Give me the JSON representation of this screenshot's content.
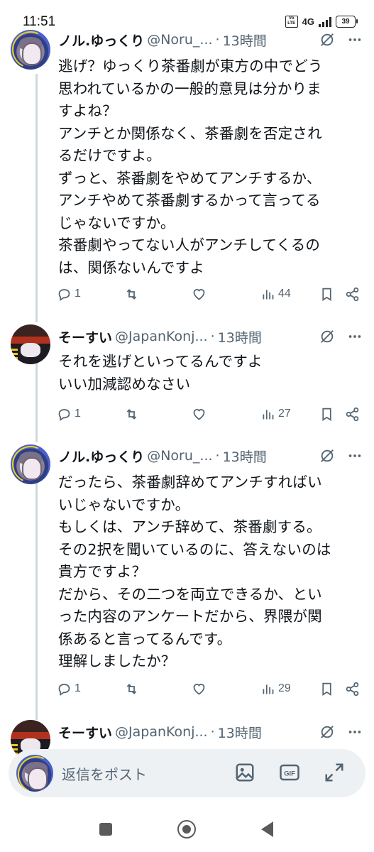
{
  "status_bar": {
    "time": "11:51",
    "volte": "Vo LTE",
    "network": "4G",
    "battery": "39"
  },
  "tweets": [
    {
      "name": "ノル.ゆっくり",
      "handle": "@Noru_...",
      "time": "13時間",
      "text": "逃げ？ゆっくり茶番劇が東方の中でどう\n思われているかの一般的意見は分かりま\nすよね？\nアンチとか関係なく、茶番劇を否定され\nるだけですよ。\nずっと、茶番劇をやめてアンチするか、\nアンチやめて茶番劇するかって言ってる\nじゃないですか。\n茶番劇やってない人がアンチしてくるの\nは、関係ないんですよ",
      "replies": "1",
      "views": "44"
    },
    {
      "name": "そーすい",
      "handle": "@JapanKonj...",
      "time": "13時間",
      "text": "それを逃げといってるんですよ\nいい加減認めなさい",
      "replies": "1",
      "views": "27"
    },
    {
      "name": "ノル.ゆっくり",
      "handle": "@Noru_...",
      "time": "13時間",
      "text": "だったら、茶番劇辞めてアンチすればい\nいじゃないですか。\nもしくは、アンチ辞めて、茶番劇する。\nその2択を聞いているのに、答えないのは\n貴方ですよ？\nだから、その二つを両立できるか、とい\nった内容のアンケートだから、界隈が関\n係あると言ってるんです。\n理解しましたか？",
      "replies": "1",
      "views": "29"
    },
    {
      "name": "そーすい",
      "handle": "@JapanKonj...",
      "time": "13時間"
    }
  ],
  "separator": "·",
  "reply_bar": {
    "placeholder": "返信をポスト",
    "gif_label": "GIF"
  },
  "icons": [
    "grok-icon",
    "more-icon",
    "reply-icon",
    "retweet-icon",
    "like-icon",
    "views-icon",
    "bookmark-icon",
    "share-icon",
    "image-icon",
    "gif-icon",
    "expand-icon"
  ],
  "colors": {
    "text": "#0f1419",
    "secondary": "#536471",
    "thread_line": "#cfd9de",
    "reply_bar_bg": "#eef1f4"
  }
}
